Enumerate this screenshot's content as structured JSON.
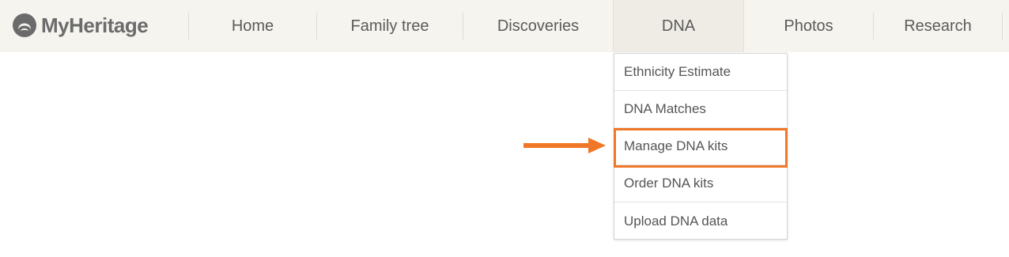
{
  "brand": {
    "name": "MyHeritage",
    "text_color": "#6b6b6b"
  },
  "nav": {
    "items": [
      {
        "label": "Home"
      },
      {
        "label": "Family tree"
      },
      {
        "label": "Discoveries"
      },
      {
        "label": "DNA",
        "active": true
      },
      {
        "label": "Photos"
      },
      {
        "label": "Research"
      }
    ],
    "background": "#f6f4ef"
  },
  "dna_menu": {
    "items": [
      {
        "label": "Ethnicity Estimate"
      },
      {
        "label": "DNA Matches"
      },
      {
        "label": "Manage DNA kits",
        "highlighted": true
      },
      {
        "label": "Order DNA kits"
      },
      {
        "label": "Upload DNA data"
      }
    ]
  },
  "annotation": {
    "color": "#f07727",
    "arrow_icon": "right-arrow-icon"
  }
}
